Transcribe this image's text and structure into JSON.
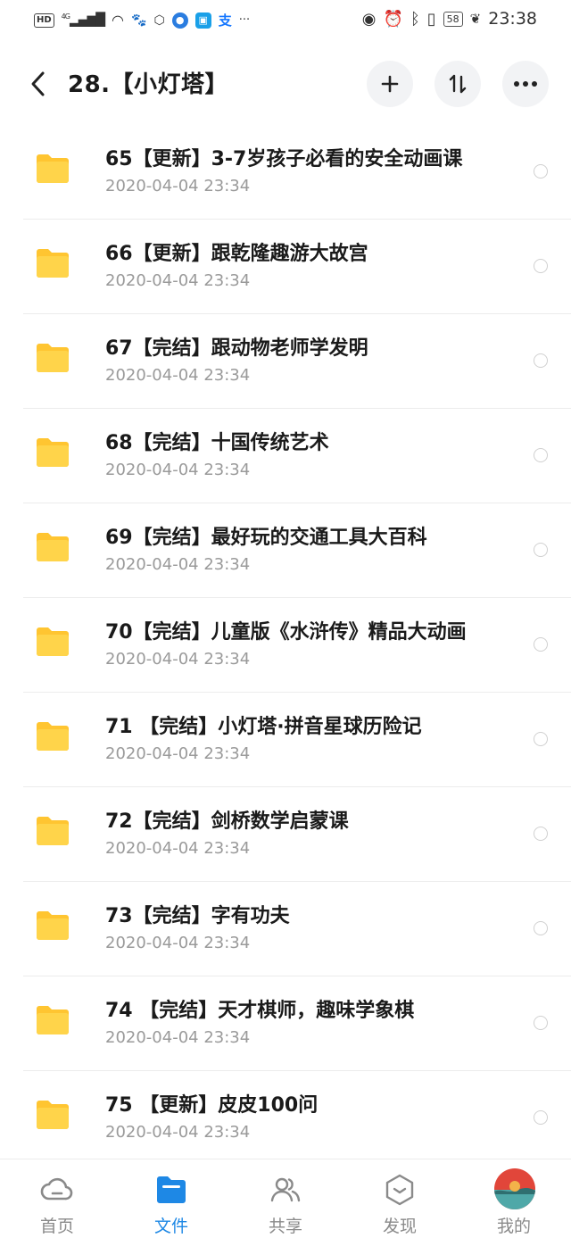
{
  "status_bar": {
    "left_badge": "HD",
    "network": "4G",
    "time": "23:38",
    "battery": "58",
    "icons": [
      "signal-icon",
      "wifi-icon",
      "cat-icon",
      "hand-icon",
      "app-icon",
      "app-icon",
      "alipay-icon",
      "more-dots-icon",
      "eye-icon",
      "alarm-icon",
      "bluetooth-icon",
      "vibrate-icon",
      "battery-icon",
      "leaf-icon"
    ]
  },
  "header": {
    "title": "28.【小灯塔】",
    "back_icon": "chevron-left-icon",
    "actions": [
      "plus-icon",
      "sort-icon",
      "more-icon"
    ]
  },
  "colors": {
    "folder": "#FFC531",
    "accent": "#1E88E5",
    "text_secondary": "#9A9A9A",
    "button_bg": "#F2F3F5"
  },
  "files": [
    {
      "name": "65【更新】3-7岁孩子必看的安全动画课",
      "date": "2020-04-04  23:34"
    },
    {
      "name": "66【更新】跟乾隆趣游大故宫",
      "date": "2020-04-04  23:34"
    },
    {
      "name": "67【完结】跟动物老师学发明",
      "date": "2020-04-04  23:34"
    },
    {
      "name": "68【完结】十国传统艺术",
      "date": "2020-04-04  23:34"
    },
    {
      "name": "69【完结】最好玩的交通工具大百科",
      "date": "2020-04-04  23:34"
    },
    {
      "name": "70【完结】儿童版《水浒传》精品大动画",
      "date": "2020-04-04  23:34"
    },
    {
      "name": "71 【完结】小灯塔·拼音星球历险记",
      "date": "2020-04-04  23:34"
    },
    {
      "name": "72【完结】剑桥数学启蒙课",
      "date": "2020-04-04  23:34"
    },
    {
      "name": "73【完结】字有功夫",
      "date": "2020-04-04  23:34"
    },
    {
      "name": "74 【完结】天才棋师，趣味学象棋",
      "date": "2020-04-04  23:34"
    },
    {
      "name": "75 【更新】皮皮100问",
      "date": "2020-04-04  23:34"
    }
  ],
  "tabs": [
    {
      "label": "首页",
      "icon": "cloud-icon",
      "active": false
    },
    {
      "label": "文件",
      "icon": "folder-icon",
      "active": true
    },
    {
      "label": "共享",
      "icon": "people-icon",
      "active": false
    },
    {
      "label": "发现",
      "icon": "discover-icon",
      "active": false
    },
    {
      "label": "我的",
      "icon": "avatar",
      "active": false
    }
  ]
}
